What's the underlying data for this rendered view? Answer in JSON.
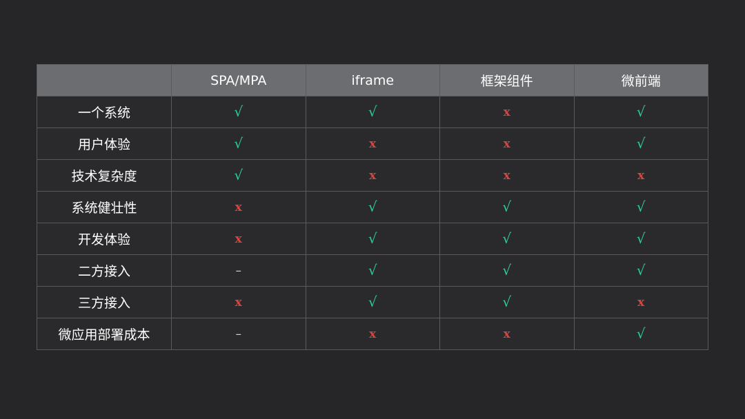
{
  "table": {
    "columns": [
      "",
      "SPA/MPA",
      "iframe",
      "框架组件",
      "微前端"
    ],
    "rows": [
      {
        "label": "一个系统",
        "cells": [
          "√",
          "√",
          "x",
          "√"
        ]
      },
      {
        "label": "用户体验",
        "cells": [
          "√",
          "x",
          "x",
          "√"
        ]
      },
      {
        "label": "技术复杂度",
        "cells": [
          "√",
          "x",
          "x",
          "x"
        ]
      },
      {
        "label": "系统健壮性",
        "cells": [
          "x",
          "√",
          "√",
          "√"
        ]
      },
      {
        "label": "开发体验",
        "cells": [
          "x",
          "√",
          "√",
          "√"
        ]
      },
      {
        "label": "二方接入",
        "cells": [
          "–",
          "√",
          "√",
          "√"
        ]
      },
      {
        "label": "三方接入",
        "cells": [
          "x",
          "√",
          "√",
          "x"
        ]
      },
      {
        "label": "微应用部署成本",
        "cells": [
          "–",
          "x",
          "x",
          "√"
        ]
      }
    ]
  },
  "colors": {
    "background": "#262628",
    "header_background": "#6c6d71",
    "yes": "#2fcaa0",
    "no": "#d7453e",
    "na": "#cfcfcf"
  }
}
